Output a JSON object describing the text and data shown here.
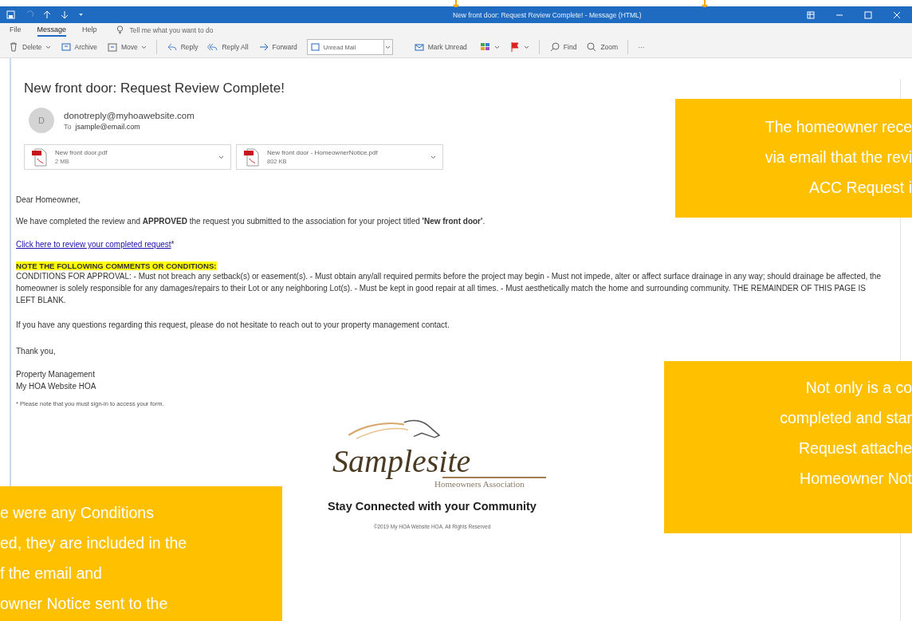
{
  "title_bar": {
    "title": "New front door: Request Review Complete!  -  Message (HTML)"
  },
  "menu_tabs": [
    {
      "label": "File",
      "selected": false
    },
    {
      "label": "Message",
      "selected": true
    },
    {
      "label": "Help",
      "selected": false
    }
  ],
  "tell_me": {
    "placeholder": "Tell me what you want to do"
  },
  "toolbar": [
    {
      "kind": "button",
      "label": "Delete",
      "dropdown": true
    },
    {
      "kind": "button",
      "label": "Archive",
      "dropdown": false
    },
    {
      "kind": "button",
      "label": "Move",
      "dropdown": true
    },
    {
      "kind": "separator"
    },
    {
      "kind": "button",
      "label": "Reply",
      "dropdown": false
    },
    {
      "kind": "button",
      "label": "Reply All",
      "dropdown": false
    },
    {
      "kind": "button",
      "label": "Forward",
      "dropdown": false
    },
    {
      "kind": "quickstep",
      "label": "Unread Mail"
    },
    {
      "kind": "button",
      "label": "Mark Unread",
      "dropdown": false
    },
    {
      "kind": "icon",
      "dropdown": true
    },
    {
      "kind": "icon",
      "dropdown": true
    },
    {
      "kind": "separator"
    },
    {
      "kind": "button",
      "label": "Find",
      "dropdown": false
    },
    {
      "kind": "button",
      "label": "Zoom",
      "dropdown": false
    },
    {
      "kind": "separator"
    },
    {
      "kind": "button",
      "label": "···",
      "dropdown": false
    }
  ],
  "email": {
    "subject": "New front door: Request Review Complete!",
    "avatar_initial": "D",
    "sender": "donotreply@myhoawebsite.com",
    "to_label": "To",
    "to": "jsample@email.com",
    "attachments": [
      {
        "name": "New front door.pdf",
        "size": "2 MB"
      },
      {
        "name": "New front door - HomeownerNotice.pdf",
        "size": "802 KB"
      }
    ],
    "greeting": "Dear Homeowner,",
    "intro": "We have completed the review and **APPROVED** the request you submitted to the association for your project titled **'New front door'**.",
    "link": "Click here to review your completed request",
    "link_mark": "*",
    "note_heading": "NOTE THE FOLLOWING COMMENTS OR CONDITIONS:",
    "conditions": "CONDITIONS FOR APPROVAL: - Must not breach any setback(s) or easement(s). - Must obtain any/all required permits before the project may begin - Must not impede, alter or affect surface drainage in any way; should drainage be affected, the homeowner is solely responsible for any damages/repairs to their Lot or any neighboring Lot(s). - Must be kept in good repair at all times. - Must aesthetically match the home and surrounding community. THE REMAINDER OF THIS PAGE IS LEFT BLANK.",
    "questions": "If you have any questions regarding this request, please do not hesitate to reach out to your property management contact.",
    "thanks": "Thank you,",
    "signature": [
      "Property Management",
      "My HOA Website HOA"
    ],
    "footnote": "* Please note that you must sign-in to access your form.",
    "footer": {
      "logo_text": "Samplesite",
      "logo_subtitle": "Homeowners Association",
      "tagline": "Stay Connected with your Community",
      "copyright": "©2019 My HOA Website HOA.  All Rights Reserved"
    }
  },
  "callouts": [
    {
      "lines": [
        "The homeowner rece",
        "via email that the revi",
        "ACC Request i"
      ]
    },
    {
      "lines": [
        "Not only is a co",
        "completed and star",
        "Request attache",
        "Homeowner Not"
      ]
    },
    {
      "lines": [
        "e were any Conditions",
        "ed, they are included in the",
        "f the email and",
        "owner Notice sent to the"
      ]
    }
  ]
}
